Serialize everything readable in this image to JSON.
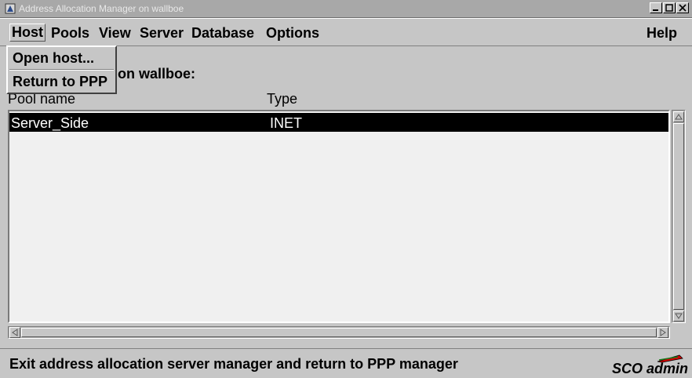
{
  "window": {
    "title": "Address Allocation Manager on wallboe",
    "controls": [
      "minimize",
      "maximize",
      "close"
    ]
  },
  "menubar": {
    "items": [
      {
        "label": "Host",
        "icon": null
      },
      {
        "label": "Pools"
      },
      {
        "label": "View"
      },
      {
        "label": "Server"
      },
      {
        "label": "Database"
      },
      {
        "label": "Options"
      },
      {
        "label": "Help"
      }
    ]
  },
  "host_menu": {
    "items": [
      "Open host...",
      "Return to PPP"
    ]
  },
  "main": {
    "heading_visible": "on wallboe:",
    "columns": [
      "Pool name",
      "Type"
    ],
    "rows": [
      {
        "pool_name": "Server_Side",
        "type": "INET",
        "selected": true
      }
    ]
  },
  "statusbar": {
    "message": "Exit address allocation server manager and return to PPP manager",
    "logo_sco": "SCO",
    "logo_admin": "admin"
  },
  "colors": {
    "titlebar": "#a8a8a8",
    "chrome": "#c6c6c6",
    "selection": "#000000",
    "list_bg": "#f0f0f0"
  },
  "icons": {
    "system_menu": "sco-window-menu-icon",
    "logo_mark": "red-flag-icon"
  }
}
